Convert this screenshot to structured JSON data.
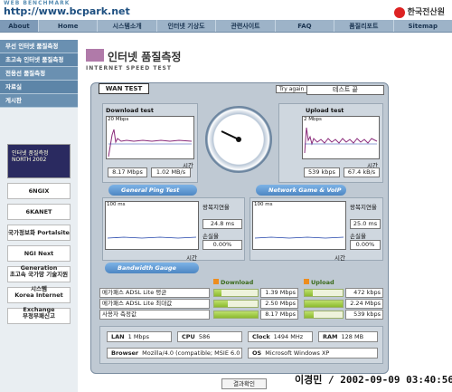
{
  "site": {
    "logo_small": "WEB BENCHMARK",
    "url": "http://www.bcpark.net",
    "brand": "한국전산원"
  },
  "nav": {
    "items": [
      "About",
      "Home",
      "시스템소개",
      "인터넷 기상도",
      "관련사이트",
      "FAQ",
      "품질리포트",
      "Sitemap"
    ]
  },
  "sidebar": {
    "menu": [
      "무선 인터넷 품질측정",
      "초고속 인터넷 품질측정",
      "전용선 품질측정",
      "자료실",
      "게시판"
    ],
    "banner": "인터넷 품질측정 NORTH 2002",
    "links": [
      "6NGIX",
      "6KANET",
      "국가정보화 Portalsite",
      "NGI Next Generation",
      "초고속 국가망 기술지원 시스템",
      "Korea Internet Exchange",
      "부정부패신고"
    ]
  },
  "page": {
    "title": "인터넷 품질측정",
    "subtitle": "INTERNET SPEED TEST"
  },
  "test": {
    "tab": "WAN TEST",
    "try_again": "Try again",
    "status": "테스트 끝",
    "download": {
      "title": "Download test",
      "scale": "20 Mbps",
      "time_label": "시간",
      "speed_mbps": "8.17 Mbps",
      "speed_mbs": "1.02 MB/s"
    },
    "upload": {
      "title": "Upload test",
      "scale": "2 Mbps",
      "time_label": "시간",
      "speed_kbps": "539 kbps",
      "speed_kbs": "67.4 kB/s"
    },
    "ping": {
      "title": "General Ping Test",
      "scale": "100 ms",
      "time_label": "시간",
      "rtt_label": "왕복지연율",
      "rtt": "24.8 ms",
      "loss_label": "손실율",
      "loss": "0.00%"
    },
    "voip": {
      "title": "Network Game & VoIP Test",
      "scale": "100 ms",
      "time_label": "시간",
      "rtt_label": "왕복지연율",
      "rtt": "25.0 ms",
      "loss_label": "손실율",
      "loss": "0.00%"
    }
  },
  "bandwidth": {
    "title": "Bandwidth Gauge",
    "download_header": "Download",
    "upload_header": "Upload",
    "rows": [
      {
        "label": "메가패스 ADSL Lite 평균",
        "download": "1.39 Mbps",
        "download_fraction": 0.17,
        "upload": "472 kbps",
        "upload_fraction": 0.21
      },
      {
        "label": "메가패스 ADSL Lite 최대값",
        "download": "2.50 Mbps",
        "download_fraction": 0.31,
        "upload": "2.24 Mbps",
        "upload_fraction": 1.0
      },
      {
        "label": "사용자 측정값",
        "download": "8.17 Mbps",
        "download_fraction": 1.0,
        "upload": "539 kbps",
        "upload_fraction": 0.24
      }
    ]
  },
  "system": {
    "lan_label": "LAN",
    "lan": "1 Mbps",
    "cpu_label": "CPU",
    "cpu": "586",
    "clock_label": "Clock",
    "clock": "1494 MHz",
    "ram_label": "RAM",
    "ram": "128 MB",
    "browser_label": "Browser",
    "browser": "Mozilla/4.0 (compatible; MSIE 6.0",
    "os_label": "OS",
    "os": "Microsoft Windows XP"
  },
  "confirm_label": "결과확인",
  "footer": "이경민 / 2002-09-09 03:40:56",
  "colors": {
    "accent": "#5d85a8",
    "chart_line": "#8a2a7a",
    "plot_line": "#2244aa",
    "gauge_fill": "#8cbb2e"
  }
}
